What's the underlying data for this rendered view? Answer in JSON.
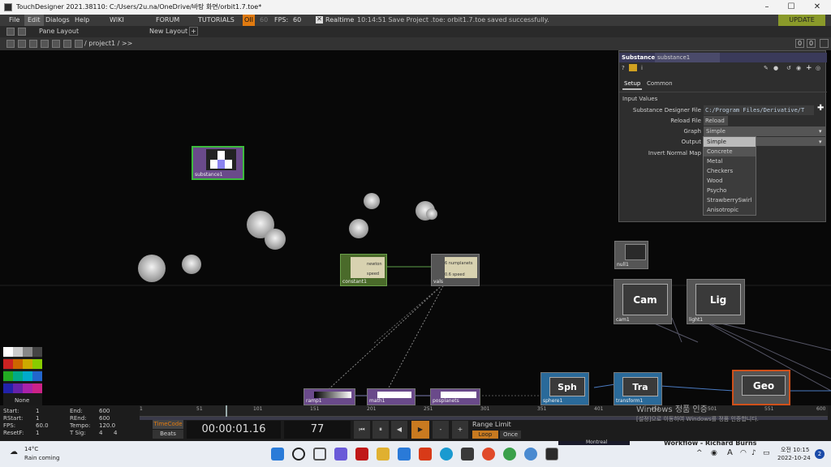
{
  "title_bar": {
    "title": "TouchDesigner 2021.38110: C:/Users/2u.na/OneDrive/바탕 화면/orbit1.7.toe*"
  },
  "menu": {
    "file": "File",
    "edit": "Edit",
    "dialogs": "Dialogs",
    "help": "Help",
    "wiki": "WIKI",
    "forum": "FORUM",
    "tutorials": "TUTORIALS",
    "oi": "OII",
    "oi_num": "60",
    "fps_label": "FPS:",
    "fps_value": "60",
    "realtime": "Realtime",
    "status": "10:14:51 Save Project .toe: orbit1.7.toe saved successfully.",
    "update": "UPDATE"
  },
  "toolbar": {
    "pane_layout": "Pane Layout",
    "new_layout": "New Layout"
  },
  "path_bar": {
    "path": "/ project1 / >>",
    "pane_num_a": "0",
    "pane_num_b": "0"
  },
  "nodes": {
    "substance": "substance1",
    "constant": "constant1",
    "constant_inner_a": "newton",
    "constant_inner_b": "speed",
    "vals": "vals",
    "vals_a": "numplanets",
    "vals_b": "speed",
    "vals_a_val": "6",
    "vals_b_val": "0.6",
    "null": "null1",
    "cam_title": "Cam",
    "cam": "cam1",
    "light_title": "Lig",
    "light": "light1",
    "ramp": "ramp1",
    "math": "math1",
    "posplanets": "posplanets",
    "sph_title": "Sph",
    "sphere": "sphere1",
    "tra_title": "Tra",
    "transform": "transform1",
    "geo_title": "Geo"
  },
  "param_panel": {
    "op_type": "Substance",
    "op_name": "substance1",
    "tab_setup": "Setup",
    "tab_common": "Common",
    "section": "Input Values",
    "file_label": "Substance Designer File",
    "file_value": "C:/Program Files/Derivative/T",
    "reload_label": "Reload File",
    "reload_btn": "Reload",
    "graph_label": "Graph",
    "graph_value": "Simple",
    "output_label": "Output",
    "invert_label": "Invert Normal Map",
    "options": [
      "Simple",
      "Concrete",
      "Metal",
      "Checkers",
      "Wood",
      "Psycho",
      "StrawberrySwirl",
      "Anisotropic"
    ]
  },
  "palette": {
    "none_label": "None",
    "colors": [
      "#ffffff",
      "#cccccc",
      "#888888",
      "#444444",
      "#cc2222",
      "#cc6600",
      "#ccaa00",
      "#88cc00",
      "#22aa22",
      "#00aa88",
      "#00aacc",
      "#2266cc",
      "#2222aa",
      "#6622aa",
      "#aa22aa",
      "#cc2288"
    ]
  },
  "timeline_info": {
    "start_label": "Start:",
    "start": "1",
    "end_label": "End:",
    "end": "600",
    "rstart_label": "RStart:",
    "rstart": "1",
    "rend_label": "REnd:",
    "rend": "600",
    "fps_label": "FPS:",
    "fps": "60.0",
    "tempo_label": "Tempo:",
    "tempo": "120.0",
    "resetf_label": "ResetF:",
    "resetf": "1",
    "tsig_label": "T Sig:",
    "tsig_a": "4",
    "tsig_b": "4",
    "timecode_btn": "TimeCode",
    "beats_btn": "Beats",
    "timecode": "00:00:01.16",
    "frame": "77",
    "range_limit": "Range Limit",
    "loop": "Loop",
    "once": "Once",
    "ticks": [
      "1",
      "51",
      "101",
      "151",
      "201",
      "251",
      "301",
      "351",
      "401",
      "451",
      "501",
      "551",
      "600"
    ]
  },
  "watermark": {
    "line1": "Windows 정품 인증",
    "line2": "[설정]으로 이동하여 Windows를 정품 인증합니다."
  },
  "taskbar": {
    "temp": "14°C",
    "weather": "Rain coming",
    "lang": "A",
    "time": "오전 10:15",
    "date": "2022-10-24",
    "notif": "2",
    "peek_a": "Montreal",
    "peek_b": "Workflow - Richard Burns"
  }
}
